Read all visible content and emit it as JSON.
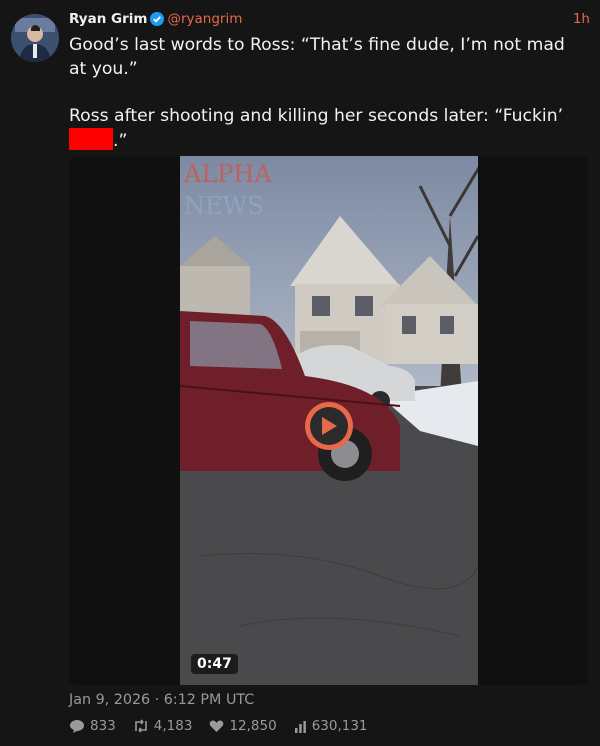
{
  "author": {
    "name": "Ryan Grim",
    "handle": "@ryangrim",
    "verified": true,
    "avatar_icon": "avatar"
  },
  "time_ago": "1h",
  "text": {
    "line1": "Good’s last words to Ross: “That’s fine dude, I’m not mad at you.”",
    "line2_before": "Ross after shooting and killing her seconds later: “Fuckin’ ",
    "line2_after": ".”"
  },
  "media": {
    "type": "video",
    "duration": "0:47",
    "watermark_line1": "ALPHA",
    "watermark_line2": "NEWS"
  },
  "timestamp": "Jan 9, 2026 · 6:12 PM UTC",
  "stats": {
    "replies": "833",
    "retweets": "4,183",
    "likes": "12,850",
    "views": "630,131"
  },
  "colors": {
    "accent": "#e8684a",
    "background": "#151515",
    "redaction": "#ff0000"
  }
}
